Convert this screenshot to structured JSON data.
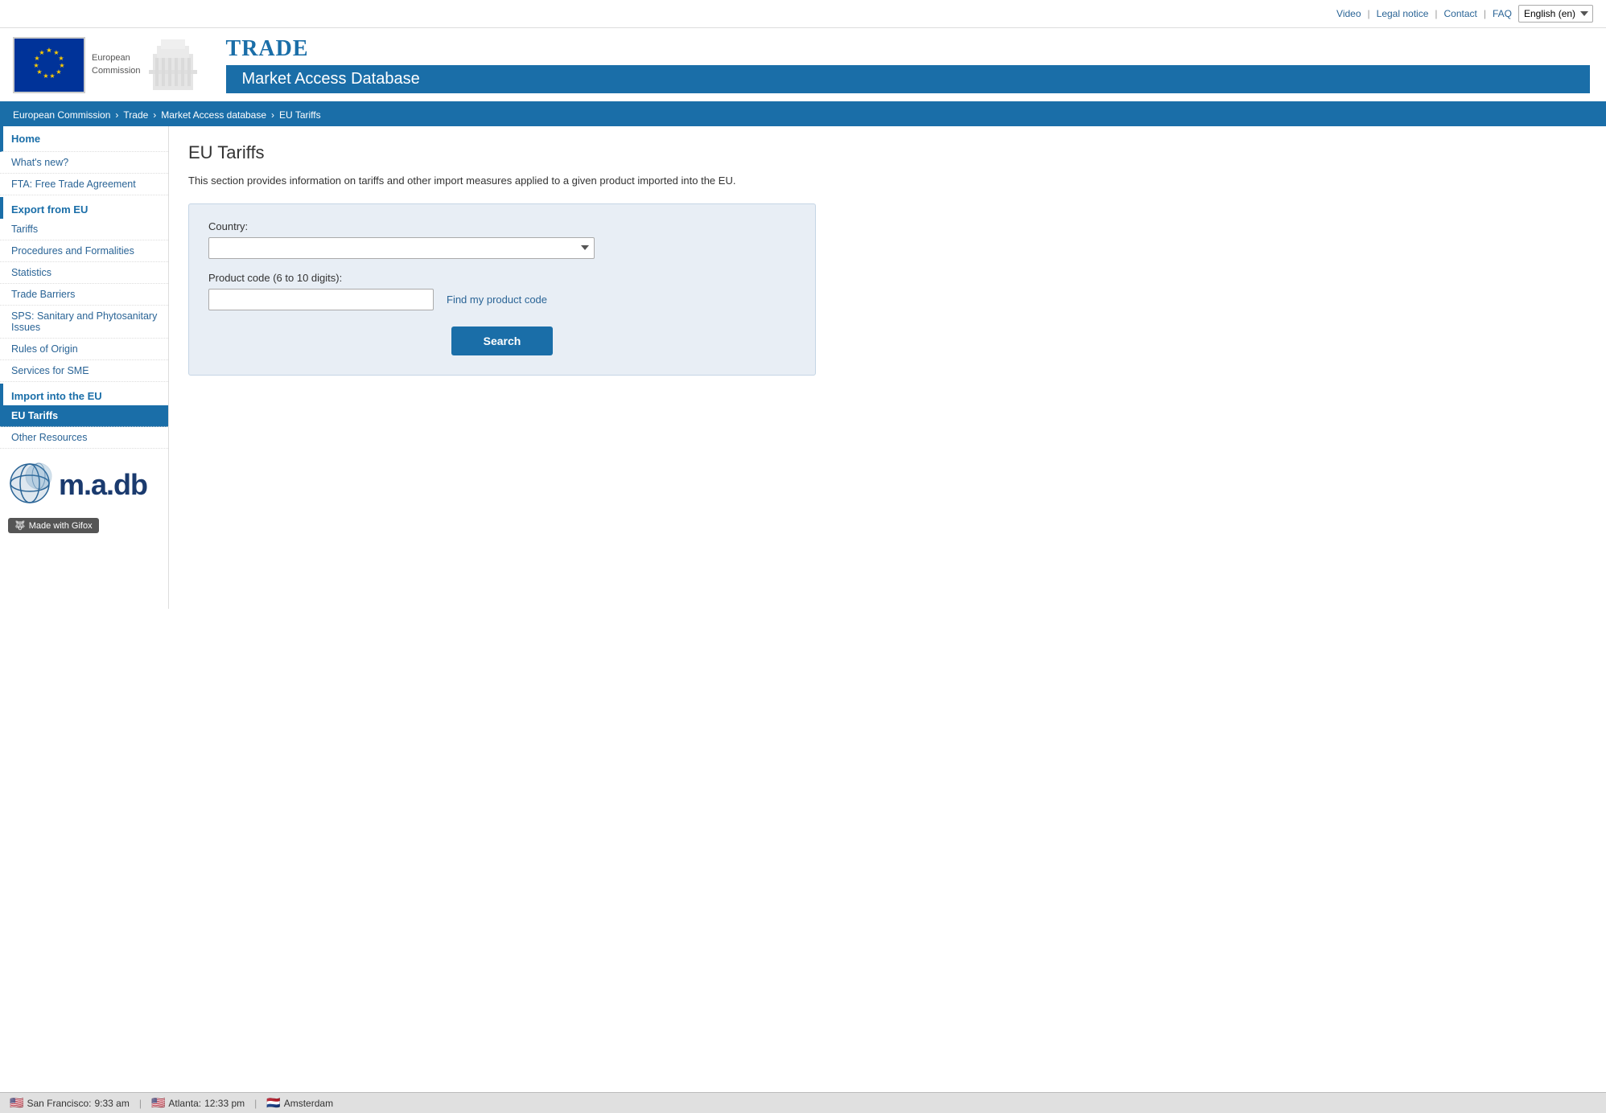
{
  "topbar": {
    "video": "Video",
    "legal": "Legal notice",
    "contact": "Contact",
    "faq": "FAQ",
    "lang": "English (en)"
  },
  "header": {
    "ec_label": "European",
    "ec_label2": "Commission",
    "trade": "TRADE",
    "subtitle": "Market Access Database"
  },
  "breadcrumb": {
    "ec": "European Commission",
    "trade": "Trade",
    "madb": "Market Access database",
    "current": "EU Tariffs"
  },
  "sidebar": {
    "home": "Home",
    "whats_new": "What's new?",
    "fta": "FTA: Free Trade Agreement",
    "export_header": "Export from EU",
    "tariffs": "Tariffs",
    "procedures": "Procedures and Formalities",
    "statistics": "Statistics",
    "trade_barriers": "Trade Barriers",
    "sps": "SPS: Sanitary and Phytosanitary Issues",
    "rules_origin": "Rules of Origin",
    "sme": "Services for SME",
    "import_header": "Import into the EU",
    "eu_tariffs": "EU Tariffs",
    "other_resources": "Other Resources",
    "madb_logo": "m.a.db",
    "gifox": "Made with Gifox"
  },
  "content": {
    "title": "EU Tariffs",
    "description": "This section provides information on tariffs and other import measures applied to a given product imported into the EU.",
    "country_label": "Country:",
    "product_code_label": "Product code (6 to 10 digits):",
    "find_code_link": "Find my product code",
    "search_btn": "Search"
  },
  "statusbar": {
    "sf_label": "San Francisco:",
    "sf_time": "9:33 am",
    "atlanta_label": "Atlanta:",
    "atlanta_time": "12:33 pm",
    "amsterdam_label": "Amsterdam"
  }
}
